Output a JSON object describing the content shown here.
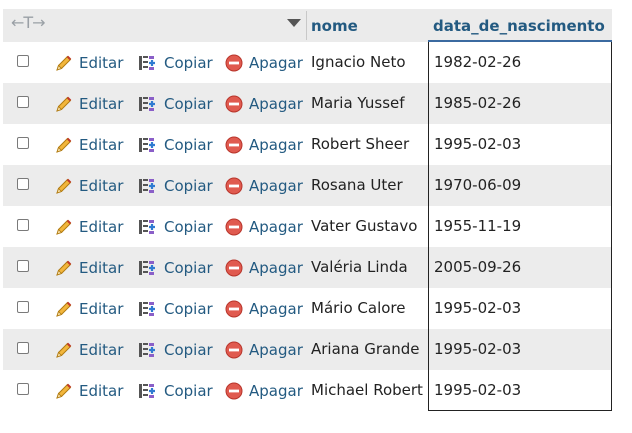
{
  "header": {
    "arrows_glyph": "←T→",
    "columns": {
      "nome": "nome",
      "data_de_nascimento": "data_de_nascimento"
    }
  },
  "actions": {
    "edit_label": "Editar",
    "copy_label": "Copiar",
    "delete_label": "Apagar"
  },
  "rows": [
    {
      "nome": "Ignacio Neto",
      "data_de_nascimento": "1982-02-26"
    },
    {
      "nome": "Maria Yussef",
      "data_de_nascimento": "1985-02-26"
    },
    {
      "nome": "Robert Sheer",
      "data_de_nascimento": "1995-02-03"
    },
    {
      "nome": "Rosana Uter",
      "data_de_nascimento": "1970-06-09"
    },
    {
      "nome": "Vater Gustavo",
      "data_de_nascimento": "1955-11-19"
    },
    {
      "nome": "Valéria Linda",
      "data_de_nascimento": "2005-09-26"
    },
    {
      "nome": "Mário Calore",
      "data_de_nascimento": "1995-02-03"
    },
    {
      "nome": "Ariana Grande",
      "data_de_nascimento": "1995-02-03"
    },
    {
      "nome": "Michael Robert",
      "data_de_nascimento": "1995-02-03"
    }
  ],
  "colors": {
    "link": "#235a81",
    "row_alt": "#ececec",
    "header_bg": "#ebebeb",
    "delete_icon": "#d9534f",
    "pencil_icon": "#e8a317",
    "copy_icon": "#7c5cbf"
  },
  "icons": {
    "edit": "pencil-icon",
    "copy": "copy-icon",
    "delete": "delete-icon",
    "sort": "sort-arrow-icon"
  }
}
